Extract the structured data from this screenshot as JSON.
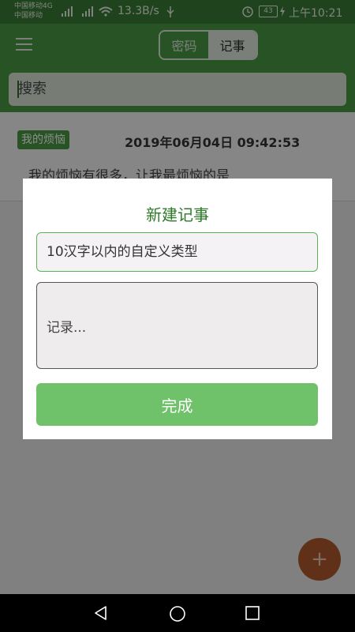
{
  "status_bar": {
    "carrier_line1": "中国移动4G",
    "carrier_line2": "中国移动",
    "net_speed": "13.3B/s",
    "battery": "43",
    "time": "上午10:21"
  },
  "header": {
    "tabs": [
      {
        "label": "密码",
        "selected": false
      },
      {
        "label": "记事",
        "selected": true
      }
    ]
  },
  "search": {
    "placeholder": "搜索"
  },
  "notes": [
    {
      "tag": "我的烦恼",
      "date": "2019年06月04日 09:42:53",
      "preview": "我的烦恼有很多，让我最烦恼的是"
    }
  ],
  "dialog": {
    "title": "新建记事",
    "type_placeholder": "10汉字以内的自定义类型",
    "note_placeholder": "记录...",
    "done_label": "完成"
  },
  "fab": {
    "icon": "+"
  },
  "colors": {
    "primary": "#4a9a44",
    "status_bar": "#3a7a34",
    "accent_button": "#6fc16a",
    "fab": "#b05a2c"
  }
}
